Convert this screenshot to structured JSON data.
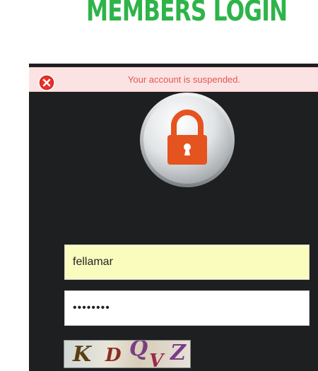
{
  "header": {
    "title": "MEMBERS LOGIN"
  },
  "alert": {
    "message": "Your account is suspended.",
    "icon": "error-icon"
  },
  "login": {
    "username_value": "fellamar",
    "password_value": "••••••••"
  },
  "captcha": {
    "characters": [
      "K",
      "D",
      "Q",
      "V",
      "Z"
    ]
  },
  "colors": {
    "title": "#2eb449",
    "panel": "#1d1f21",
    "alert_bg": "#fbe3e4",
    "alert_text": "#e2574c",
    "lock": "#e5531f",
    "username_bg": "#fafcbe"
  }
}
